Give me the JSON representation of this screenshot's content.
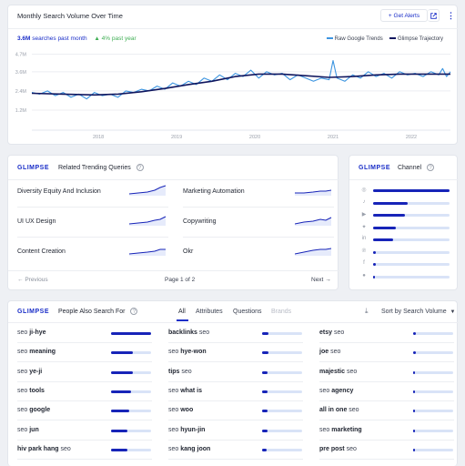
{
  "volume_card": {
    "title": "Monthly Search Volume Over Time",
    "get_alerts_label": "Get Alerts",
    "searches_value": "3.6M",
    "searches_label": "searches past month",
    "yoy_value": "4% past year",
    "legend_raw": "Raw Google Trends",
    "legend_trajectory": "Glimpse Trajectory",
    "colors": {
      "raw": "#3d95e0",
      "trajectory": "#10165e",
      "positive": "#3fae54",
      "accent": "#1a2ec8"
    }
  },
  "chart_data": {
    "type": "line",
    "title": "Monthly Search Volume Over Time",
    "xlabel": "",
    "ylabel": "",
    "y_ticks": [
      "4.7M",
      "3.6M",
      "2.4M",
      "1.2M"
    ],
    "x_ticks": [
      "2018",
      "2019",
      "2020",
      "2021",
      "2022"
    ],
    "ylim": [
      0,
      4.9
    ],
    "x_range": [
      2017.4,
      2022.75
    ],
    "grid": true,
    "legend_position": "top-right",
    "series": [
      {
        "name": "Raw Google Trends",
        "x": [
          2017.4,
          2017.5,
          2017.6,
          2017.7,
          2017.8,
          2017.9,
          2018.0,
          2018.1,
          2018.2,
          2018.3,
          2018.4,
          2018.5,
          2018.6,
          2018.7,
          2018.8,
          2018.9,
          2019.0,
          2019.1,
          2019.2,
          2019.3,
          2019.4,
          2019.5,
          2019.6,
          2019.7,
          2019.8,
          2019.9,
          2020.0,
          2020.1,
          2020.2,
          2020.3,
          2020.4,
          2020.5,
          2020.6,
          2020.7,
          2020.8,
          2020.9,
          2021.0,
          2021.1,
          2021.2,
          2021.25,
          2021.3,
          2021.4,
          2021.5,
          2021.6,
          2021.7,
          2021.8,
          2021.9,
          2022.0,
          2022.1,
          2022.2,
          2022.3,
          2022.4,
          2022.5,
          2022.6,
          2022.65,
          2022.7,
          2022.75
        ],
        "y": [
          2.3,
          2.2,
          2.4,
          2.1,
          2.3,
          2.0,
          2.2,
          1.9,
          2.3,
          2.1,
          2.2,
          2.0,
          2.4,
          2.3,
          2.5,
          2.4,
          2.7,
          2.5,
          2.9,
          2.7,
          3.0,
          2.8,
          3.2,
          3.0,
          3.4,
          3.1,
          3.5,
          3.3,
          3.7,
          3.2,
          3.6,
          3.4,
          3.5,
          3.1,
          3.4,
          3.2,
          3.0,
          3.2,
          3.1,
          4.3,
          3.2,
          3.0,
          3.4,
          3.2,
          3.6,
          3.3,
          3.5,
          3.2,
          3.6,
          3.4,
          3.5,
          3.3,
          3.6,
          3.4,
          3.8,
          3.3,
          3.6
        ]
      },
      {
        "name": "Glimpse Trajectory",
        "x": [
          2017.4,
          2017.8,
          2018.2,
          2018.5,
          2018.8,
          2019.1,
          2019.4,
          2019.7,
          2020.0,
          2020.3,
          2020.6,
          2020.9,
          2021.2,
          2021.5,
          2021.8,
          2022.1,
          2022.4,
          2022.75
        ],
        "y": [
          2.25,
          2.2,
          2.15,
          2.2,
          2.35,
          2.55,
          2.8,
          3.0,
          3.3,
          3.45,
          3.45,
          3.35,
          3.25,
          3.3,
          3.4,
          3.45,
          3.45,
          3.45
        ]
      }
    ]
  },
  "related": {
    "brand": "GLIMPSE",
    "title": "Related Trending Queries",
    "queries": [
      "Diversity Equity And Inclusion",
      "Marketing Automation",
      "UI UX Design",
      "Copywriting",
      "Content Creation",
      "Okr"
    ],
    "previous_label": "Previous",
    "page_label": "Page 1 of 2",
    "next_label": "Next"
  },
  "channel": {
    "brand": "GLIMPSE",
    "title": "Channel",
    "rows": [
      {
        "icon": "instagram-icon",
        "value": 1.0
      },
      {
        "icon": "tiktok-icon",
        "value": 0.45
      },
      {
        "icon": "youtube-icon",
        "value": 0.42
      },
      {
        "icon": "twitter-icon",
        "value": 0.3
      },
      {
        "icon": "linkedin-icon",
        "value": 0.26
      },
      {
        "icon": "pinterest-icon",
        "value": 0.03
      },
      {
        "icon": "facebook-icon",
        "value": 0.03
      },
      {
        "icon": "reddit-icon",
        "value": 0.02
      }
    ]
  },
  "people": {
    "brand": "GLIMPSE",
    "title": "People Also Search For",
    "tabs": [
      "All",
      "Attributes",
      "Questions",
      "Brands"
    ],
    "sort_label": "Sort by Search Volume",
    "columns": [
      [
        {
          "prefix": "seo",
          "term": "ji-hye",
          "suffix": "",
          "value": 1.0
        },
        {
          "prefix": "seo",
          "term": "meaning",
          "suffix": "",
          "value": 0.55
        },
        {
          "prefix": "seo",
          "term": "ye-ji",
          "suffix": "",
          "value": 0.55
        },
        {
          "prefix": "seo",
          "term": "tools",
          "suffix": "",
          "value": 0.5
        },
        {
          "prefix": "seo",
          "term": "google",
          "suffix": "",
          "value": 0.45
        },
        {
          "prefix": "seo",
          "term": "jun",
          "suffix": "",
          "value": 0.42
        },
        {
          "prefix": "",
          "term": "hiv park hang",
          "suffix": "seo",
          "value": 0.4
        }
      ],
      [
        {
          "prefix": "",
          "term": "backlinks",
          "suffix": "seo",
          "value": 0.15
        },
        {
          "prefix": "seo",
          "term": "hye-won",
          "suffix": "",
          "value": 0.15
        },
        {
          "prefix": "",
          "term": "tips",
          "suffix": "seo",
          "value": 0.14
        },
        {
          "prefix": "seo",
          "term": "what is",
          "suffix": "",
          "value": 0.14
        },
        {
          "prefix": "seo",
          "term": "woo",
          "suffix": "",
          "value": 0.13
        },
        {
          "prefix": "seo",
          "term": "hyun-jin",
          "suffix": "",
          "value": 0.13
        },
        {
          "prefix": "seo",
          "term": "kang joon",
          "suffix": "",
          "value": 0.12
        }
      ],
      [
        {
          "prefix": "",
          "term": "etsy",
          "suffix": "seo",
          "value": 0.06
        },
        {
          "prefix": "",
          "term": "joe",
          "suffix": "seo",
          "value": 0.06
        },
        {
          "prefix": "",
          "term": "majestic",
          "suffix": "seo",
          "value": 0.05
        },
        {
          "prefix": "seo",
          "term": "agency",
          "suffix": "",
          "value": 0.05
        },
        {
          "prefix": "",
          "term": "all in one",
          "suffix": "seo",
          "value": 0.05
        },
        {
          "prefix": "seo",
          "term": "marketing",
          "suffix": "",
          "value": 0.05
        },
        {
          "prefix": "",
          "term": "pre post",
          "suffix": "seo",
          "value": 0.04
        }
      ]
    ]
  }
}
